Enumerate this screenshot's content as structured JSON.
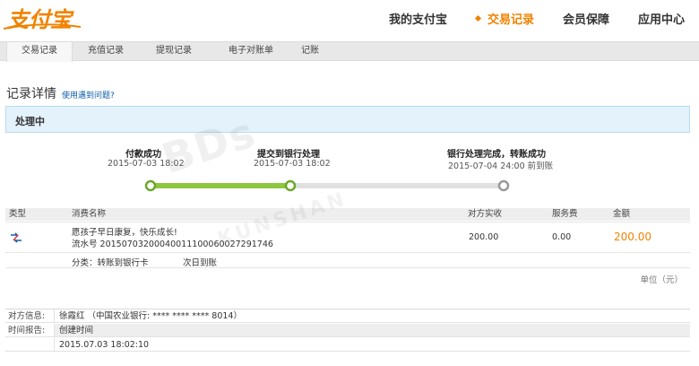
{
  "logo": {
    "text": "支付宝"
  },
  "nav": [
    {
      "label": "我的支付宝"
    },
    {
      "label": "交易记录"
    },
    {
      "label": "会员保障"
    },
    {
      "label": "应用中心"
    }
  ],
  "subnav": [
    {
      "label": "交易记录"
    },
    {
      "label": "充值记录"
    },
    {
      "label": "提现记录"
    },
    {
      "label": "电子对账单"
    },
    {
      "label": "记账"
    }
  ],
  "page": {
    "title": "记录详情",
    "help_link": "使用遇到问题?",
    "status": "处理中"
  },
  "progress": {
    "steps": [
      {
        "label": "付款成功",
        "time": "2015-07-03 18:02"
      },
      {
        "label": "提交到银行处理",
        "time": "2015-07-03 18:02"
      },
      {
        "label": "银行处理完成，转账成功",
        "time": "2015-07-04 24:00 前到账"
      }
    ],
    "completed_steps": 2
  },
  "table": {
    "headers": [
      "类型",
      "消费名称",
      "对方实收",
      "服务费",
      "金额"
    ],
    "row": {
      "name": "愿孩子早日康复，快乐成长!",
      "serial": "流水号 20150703200040011100060027291746",
      "received": "200.00",
      "fee": "0.00",
      "amount": "200.00",
      "category": "分类：转账到银行卡",
      "arrival": "次日到账"
    },
    "unit": "单位（元）"
  },
  "info": {
    "counterpart_label": "对方信息:",
    "counterpart_value": "徐霞红 （中国农业银行: **** **** **** 8014）",
    "time_label": "时间报告:",
    "time_header": "创建时间",
    "time_value": "2015.07.03 18:02:10"
  },
  "colors": {
    "accent": "#f08300",
    "progress": "#8dc63f",
    "link": "#0a5ba9"
  }
}
